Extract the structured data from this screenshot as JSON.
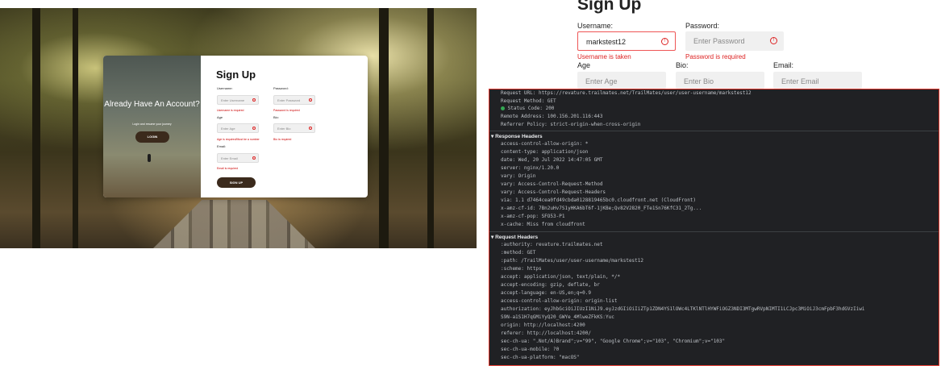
{
  "modal": {
    "left_title": "Already Have An Account?",
    "left_subtitle": "Login and resume your journey",
    "login_label": "LOGIN",
    "title": "Sign Up",
    "username_label": "Username:",
    "username_placeholder": "Enter Username",
    "username_error": "Username is required",
    "password_label": "Password:",
    "password_placeholder": "Enter Password",
    "password_error": "Password is required",
    "age_label": "Age",
    "age_placeholder": "Enter Age",
    "age_error": "Age is required/Must be a number",
    "bio_label": "Bio:",
    "bio_placeholder": "Enter Bio",
    "bio_error": "Bio is required",
    "email_label": "Email:",
    "email_placeholder": "Enter Email",
    "email_error": "Email is required",
    "signup_label": "SIGN UP"
  },
  "zoom": {
    "title": "Sign Up",
    "username_label": "Username:",
    "username_value": "markstest12",
    "username_error": "Username is taken",
    "password_label": "Password:",
    "password_placeholder": "Enter Password",
    "password_error": "Password is required",
    "age_label": "Age",
    "age_placeholder": "Enter Age",
    "bio_label": "Bio:",
    "bio_placeholder": "Enter Bio",
    "email_label": "Email:",
    "email_placeholder": "Enter Email",
    "error_icon": "!"
  },
  "devtools": {
    "general": [
      "Request URL: https://revature.trailmates.net/TrailMates/user/user-username/markstest12",
      "Request Method: GET",
      "Status Code: 200",
      "Remote Address: 100.156.201.116:443",
      "Referrer Policy: strict-origin-when-cross-origin"
    ],
    "response_title": "▾ Response Headers",
    "response": [
      "access-control-allow-origin: *",
      "content-type: application/json",
      "date: Wed, 20 Jul 2022 14:47:05 GMT",
      "server: nginx/1.20.0",
      "vary: Origin",
      "vary: Access-Control-Request-Method",
      "vary: Access-Control-Request-Headers",
      "via: 1.1 d7464cea0fd49cbda0128819465bc0.cloudfront.net (CloudFront)",
      "x-amz-cf-id: 7Bn2uHv7S1yHKA6bT6f-1jKBe;Qv82V2820_FTe1Sn76KfC31_2Tg...",
      "x-amz-cf-pop: SFO53-P1",
      "x-cache: Miss from cloudfront"
    ],
    "request_title": "▾ Request Headers",
    "request": [
      ":authority: revature.trailmates.net",
      ":method: GET",
      ":path: /TrailMates/user/user-username/markstest12",
      ":scheme: https",
      "accept: application/json, text/plain, */*",
      "accept-encoding: gzip, deflate, br",
      "accept-language: en-US,en;q=0.9",
      "access-control-allow-origin: origin-list",
      "authorization: eyJhbGciOiJIUzI1NiJ9.eyJzdGIiOiIiZTp1ZDN4YS1lOWc4LTKlNTlHYWFiOGZ3NDI3MTgwRVpNIMTI1LCJpc3MiOiJ3cmFpbF3hdGVzIiwi",
      "S9N-a1S1H7qGMiYyQ20_GWYe_4MlweZFkKS:Yuc",
      "origin: http://localhost:4200",
      "referer: http://localhost:4200/",
      "sec-ch-ua: \".Not/A)Brand\";v=\"99\", \"Google Chrome\";v=\"103\", \"Chromium\";v=\"103\"",
      "sec-ch-ua-mobile: ?0",
      "sec-ch-ua-platform: \"macOS\""
    ]
  }
}
